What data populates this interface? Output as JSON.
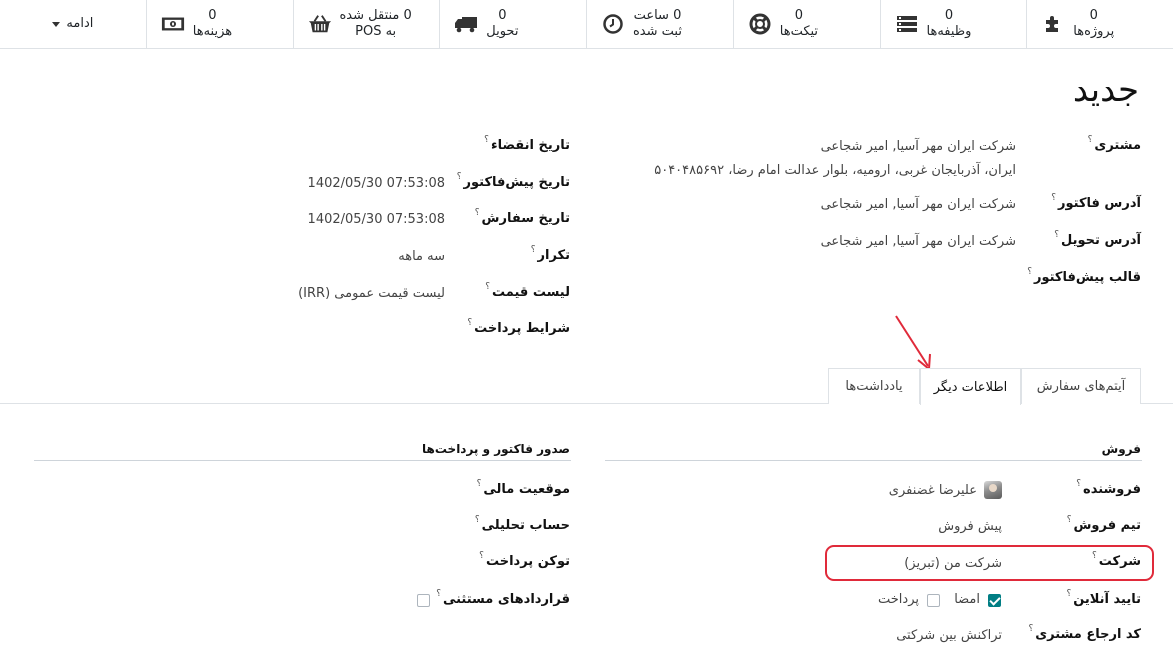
{
  "smart_buttons": [
    {
      "count": "0",
      "label": "پروژه‌ها",
      "icon": "puzzle-icon"
    },
    {
      "count": "0",
      "label": "وظیفه‌ها",
      "icon": "tasks-icon"
    },
    {
      "count": "0",
      "label": "تیکت‌ها",
      "icon": "lifebuoy-icon"
    },
    {
      "count": "0 ساعت",
      "label": "ثبت شده",
      "icon": "clock-icon"
    },
    {
      "count": "0",
      "label": "تحویل",
      "icon": "truck-icon"
    },
    {
      "count": "0 منتقل شده",
      "label": "به POS",
      "icon": "basket-icon"
    },
    {
      "count": "0",
      "label": "هزینه‌ها",
      "icon": "money-icon"
    }
  ],
  "more_label": "ادامه",
  "title": "جدید",
  "left_fields": {
    "customer_label": "مشتری",
    "customer_name": "شرکت ایران مهر آسیا, امیر شجاعی",
    "customer_address": "ایران، آذربایجان غربی، ارومیه، بلوار عدالت امام رضا، ۵۰۴۰۴۸۵۶۹۲",
    "invoice_address_label": "آدرس فاکتور",
    "invoice_address": "شرکت ایران مهر آسیا, امیر شجاعی",
    "delivery_address_label": "آدرس تحویل",
    "delivery_address": "شرکت ایران مهر آسیا, امیر شجاعی",
    "quote_template_label": "قالب پیش‌فاکتور"
  },
  "right_fields": {
    "expiration_label": "تاریخ انقضاء",
    "quote_date_label": "تاریخ پیش‌فاکتور",
    "quote_date": "1402/05/30 07:53:08",
    "order_date_label": "تاریخ سفارش",
    "order_date": "1402/05/30 07:53:08",
    "recurrence_label": "تکرار",
    "recurrence": "سه ماهه",
    "pricelist_label": "لیست قیمت",
    "pricelist": "لیست قیمت عمومی (IRR)",
    "payment_terms_label": "شرایط پرداخت"
  },
  "tabs": [
    {
      "label": "آیتم‌های سفارش",
      "active": false
    },
    {
      "label": "اطلاعات دیگر",
      "active": true
    },
    {
      "label": "یادداشت‌ها",
      "active": false
    }
  ],
  "sales_section": {
    "header": "فروش",
    "salesperson_label": "فروشنده",
    "salesperson": "علیرضا غضنفری",
    "team_label": "تیم فروش",
    "team": "پیش فروش",
    "company_label": "شرکت",
    "company": "شرکت من (تبریز)",
    "online_confirm_label": "تایید آنلاین",
    "signature_label": "امضا",
    "payment_label": "پرداخت",
    "customer_ref_label": "کد ارجاع مشتری",
    "customer_ref": "تراکنش بین شرکتی"
  },
  "invoicing_section": {
    "header": "صدور فاکتور و پرداخت‌ها",
    "fiscal_position_label": "موقعیت مالی",
    "analytic_account_label": "حساب تحلیلی",
    "payment_token_label": "توکن پرداخت",
    "standalone_contracts_label": "قراردادهای مستثنی"
  },
  "help_mark": "؟",
  "colors": {
    "accent": "#017e84",
    "highlight": "#e02a3a"
  }
}
